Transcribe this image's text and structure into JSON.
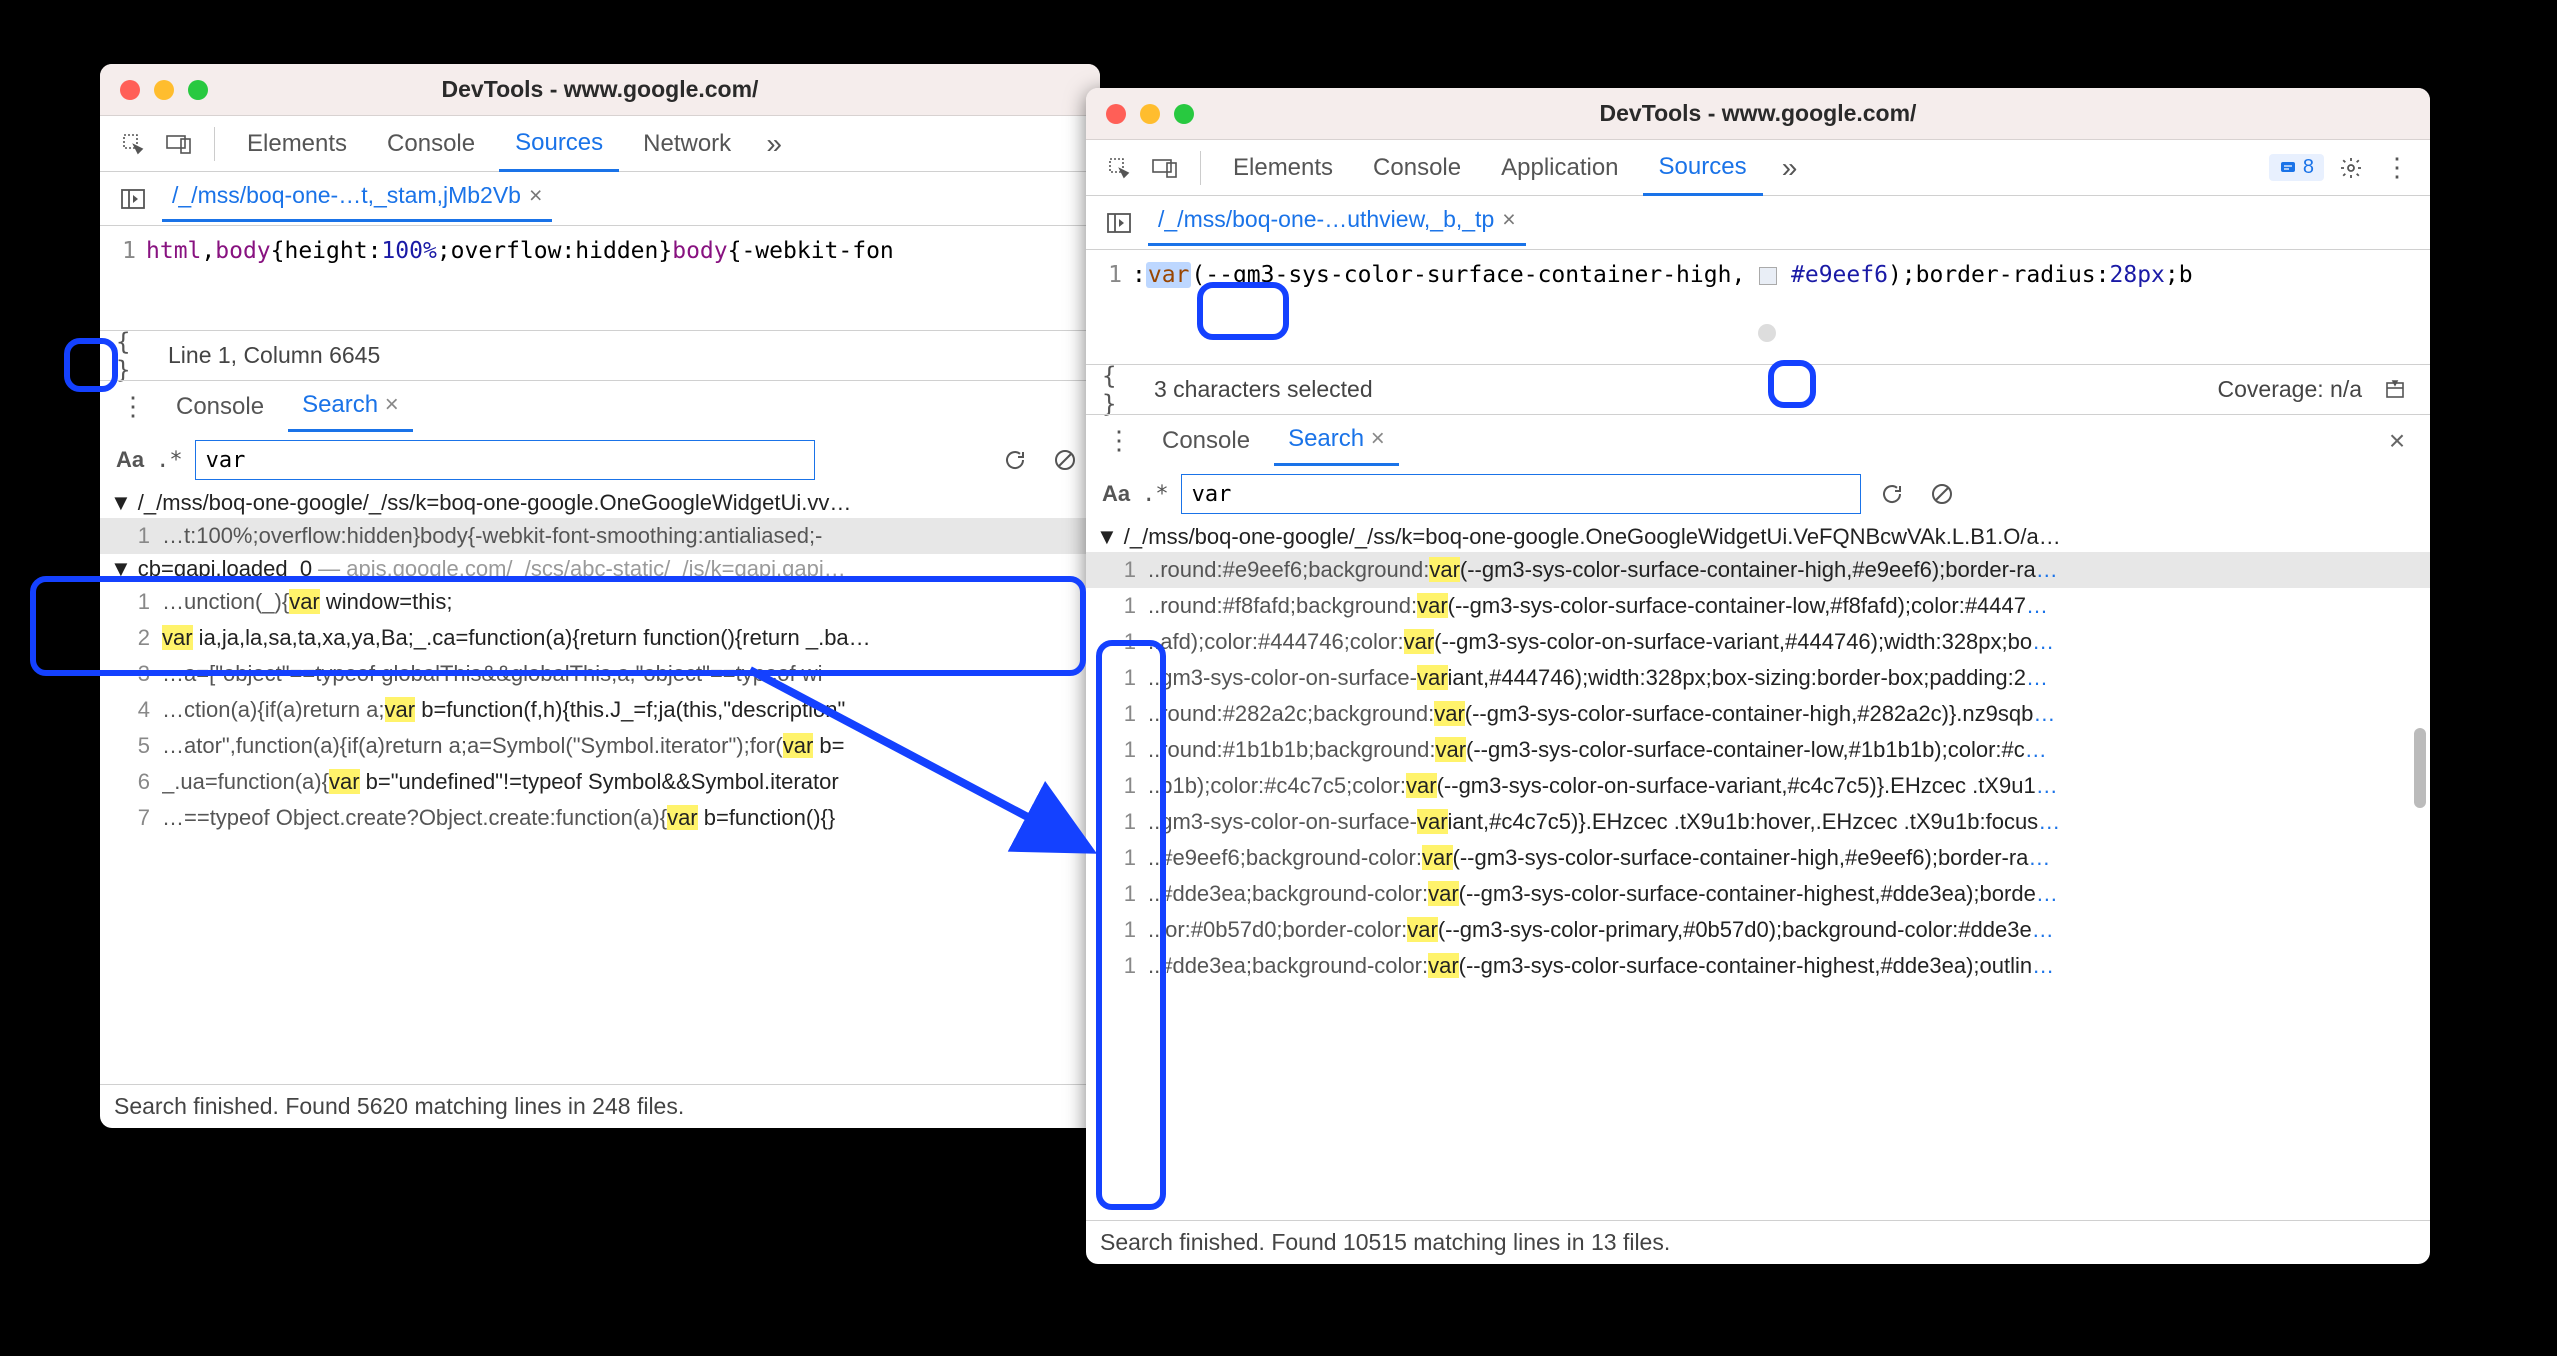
{
  "winA": {
    "title": "DevTools - www.google.com/",
    "tabs": [
      "Elements",
      "Console",
      "Sources",
      "Network"
    ],
    "activeTab": "Sources",
    "fileTab": "/_/mss/boq-one-…t,_stam,jMb2Vb",
    "codeLineNum": "1",
    "code": {
      "pre": "html",
      "mid1": ",",
      "body": "body",
      "mid2": "{height:",
      "pct": "100%",
      "mid3": ";overflow:hidden}",
      "body2": "body",
      "mid4": "{-webkit-fon"
    },
    "status": "Line 1, Column 6645",
    "drawerTabs": [
      "Console",
      "Search"
    ],
    "drawerActive": "Search",
    "searchValue": "var",
    "results": [
      {
        "type": "file",
        "text": "/_/mss/boq-one-google/_/ss/k=boq-one-google.OneGoogleWidgetUi.vv…"
      },
      {
        "type": "line",
        "ln": "1",
        "selected": true,
        "pre": "…t:100%;overflow:hidden}body{-webkit-font-smoothing:antialiased;-",
        "match": "",
        "post": ""
      },
      {
        "type": "file",
        "text": "cb=gapi.loaded_0",
        "dim": " — apis.google.com/_/scs/abc-static/_/js/k=gapi.gapi…"
      },
      {
        "type": "line",
        "ln": "1",
        "pre": "…unction(_){",
        "match": "var",
        "post": " window=this;"
      },
      {
        "type": "line",
        "ln": "2",
        "pre": "",
        "match": "var",
        "post": " ia,ja,la,sa,ta,xa,ya,Ba;_.ca=function(a){return function(){return _.ba…"
      },
      {
        "type": "line",
        "ln": "3",
        "pre": "…a=[\"object\"==typeof globalThis&&globalThis,a,\"object\"==typeof wi",
        "match": "",
        "post": ""
      },
      {
        "type": "line",
        "ln": "4",
        "pre": "…ction(a){if(a)return a;",
        "match": "var",
        "post": " b=function(f,h){this.J_=f;ja(this,\"description\""
      },
      {
        "type": "line",
        "ln": "5",
        "pre": "…ator\",function(a){if(a)return a;a=Symbol(\"Symbol.iterator\");for(",
        "match": "var",
        "post": " b="
      },
      {
        "type": "line",
        "ln": "6",
        "pre": "_.ua=function(a){",
        "match": "var",
        "post": " b=\"undefined\"!=typeof Symbol&&Symbol.iterator"
      },
      {
        "type": "line",
        "ln": "7",
        "pre": "…==typeof Object.create?Object.create:function(a){",
        "match": "var",
        "post": " b=function(){}"
      }
    ],
    "footer": "Search finished.  Found 5620 matching lines in 248 files."
  },
  "winB": {
    "title": "DevTools - www.google.com/",
    "tabs": [
      "Elements",
      "Console",
      "Application",
      "Sources"
    ],
    "activeTab": "Sources",
    "badgeCount": "8",
    "fileTab": "/_/mss/boq-one-…uthview,_b,_tp",
    "codeLineNum": "1",
    "code": {
      "pre": ":",
      "var": "var",
      "mid1": "(--gm3-sys-color-surface-container-high, ",
      "sw": "#e9eef6",
      "mid2": ");border-radius:",
      "px": "28px",
      "mid3": ";b"
    },
    "status": "3 characters selected",
    "statusRight": "Coverage: n/a",
    "drawerTabs": [
      "Console",
      "Search"
    ],
    "drawerActive": "Search",
    "searchValue": "var",
    "results": [
      {
        "type": "file",
        "text": "/_/mss/boq-one-google/_/ss/k=boq-one-google.OneGoogleWidgetUi.VeFQNBcwVAk.L.B1.O/a…"
      },
      {
        "type": "line",
        "ln": "1",
        "selected": true,
        "pre": "..round:#e9eef6;background:",
        "match": "var",
        "post": "(--gm3-sys-color-surface-container-high,#e9eef6);border-ra",
        "trail": "…"
      },
      {
        "type": "line",
        "ln": "1",
        "pre": "..round:#f8fafd;background:",
        "match": "var",
        "post": "(--gm3-sys-color-surface-container-low,#f8fafd);color:#4447",
        "trail": "…"
      },
      {
        "type": "line",
        "ln": "1",
        "pre": "..afd);color:#444746;color:",
        "match": "var",
        "post": "(--gm3-sys-color-on-surface-variant,#444746);width:328px;bo",
        "trail": "…"
      },
      {
        "type": "line",
        "ln": "1",
        "pre": "..gm3-sys-color-on-surface-",
        "match": "var",
        "post": "iant,#444746);width:328px;box-sizing:border-box;padding:2",
        "trail": "…"
      },
      {
        "type": "line",
        "ln": "1",
        "pre": "..round:#282a2c;background:",
        "match": "var",
        "post": "(--gm3-sys-color-surface-container-high,#282a2c)}.nz9sqb",
        "trail": "…"
      },
      {
        "type": "line",
        "ln": "1",
        "pre": "..round:#1b1b1b;background:",
        "match": "var",
        "post": "(--gm3-sys-color-surface-container-low,#1b1b1b);color:#c",
        "trail": "…"
      },
      {
        "type": "line",
        "ln": "1",
        "pre": "..b1b);color:#c4c7c5;color:",
        "match": "var",
        "post": "(--gm3-sys-color-on-surface-variant,#c4c7c5)}.EHzcec .tX9u1",
        "trail": "…"
      },
      {
        "type": "line",
        "ln": "1",
        "pre": "..gm3-sys-color-on-surface-",
        "match": "var",
        "post": "iant,#c4c7c5)}.EHzcec .tX9u1b:hover,.EHzcec .tX9u1b:focus",
        "trail": "…"
      },
      {
        "type": "line",
        "ln": "1",
        "pre": "..#e9eef6;background-color:",
        "match": "var",
        "post": "(--gm3-sys-color-surface-container-high,#e9eef6);border-ra",
        "trail": "…"
      },
      {
        "type": "line",
        "ln": "1",
        "pre": "..#dde3ea;background-color:",
        "match": "var",
        "post": "(--gm3-sys-color-surface-container-highest,#dde3ea);borde",
        "trail": "…"
      },
      {
        "type": "line",
        "ln": "1",
        "pre": "..lor:#0b57d0;border-color:",
        "match": "var",
        "post": "(--gm3-sys-color-primary,#0b57d0);background-color:#dde3e",
        "trail": "…"
      },
      {
        "type": "line",
        "ln": "1",
        "pre": "..#dde3ea;background-color:",
        "match": "var",
        "post": "(--gm3-sys-color-surface-container-highest,#dde3ea);outlin",
        "trail": "…"
      }
    ],
    "footer": "Search finished.  Found 10515 matching lines in 13 files."
  }
}
